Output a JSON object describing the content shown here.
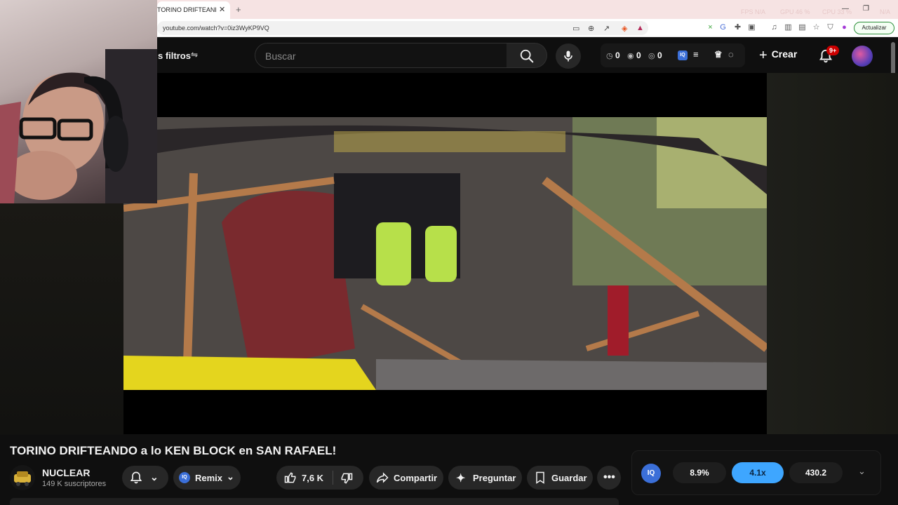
{
  "browser": {
    "tab_title": "TORINO DRIFTEANDO a lo KEN BLOCK en SAN RAFAEL!",
    "tab_title_visible": "TORINO DRIFTEANDO a",
    "url": "youtube.com/watch?v=0iz3WyKP9VQ",
    "hud": {
      "fps": "FPS N/A",
      "gpu": "GPU 46 %",
      "cpu": "CPU 33 %",
      "na": "N/A"
    },
    "update_label": "Actualizar"
  },
  "header": {
    "filters_label": "s filtros",
    "search_placeholder": "Buscar",
    "stats": [
      "0",
      "0",
      "0"
    ],
    "create_label": "Crear",
    "notif_count": "9+"
  },
  "video": {
    "title": "TORINO DRIFTEANDO a lo KEN BLOCK en SAN RAFAEL!"
  },
  "channel": {
    "name": "NUCLEAR",
    "subs": "149 K suscriptores"
  },
  "actions": {
    "remix_label": "Remix",
    "likes": "7,6 K",
    "share_label": "Compartir",
    "ask_label": "Preguntar",
    "save_label": "Guardar"
  },
  "extension": {
    "badge": "IQ",
    "values": [
      "8.9%",
      "4.1x",
      "430.2"
    ]
  },
  "colors": {
    "accent": "#3ea6ff",
    "notif": "#cc0000",
    "background": "#0f0f0f"
  }
}
